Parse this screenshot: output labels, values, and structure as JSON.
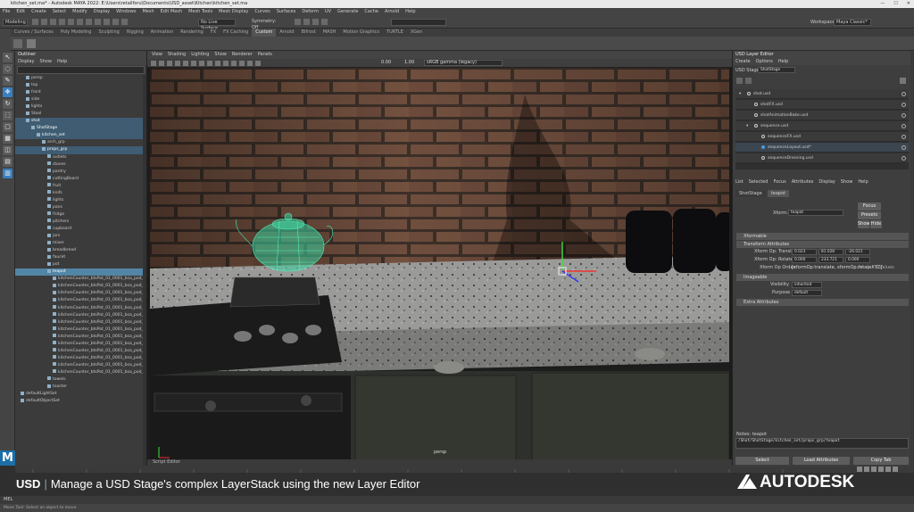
{
  "app": {
    "title": "kitchen_set.ma* - Autodesk MAYA 2022: E:\\Users\\retailforu\\Documents\\USD_asset\\Kitchen\\kitchen_set.ma",
    "window_controls": [
      "—",
      "☐",
      "✕"
    ]
  },
  "menubar": {
    "items": [
      "File",
      "Edit",
      "Create",
      "Select",
      "Modify",
      "Display",
      "Windows",
      "Mesh",
      "Edit Mesh",
      "Mesh Tools",
      "Mesh Display",
      "Curves",
      "Surfaces",
      "Deform",
      "UV",
      "Generate",
      "Cache",
      "Arnold",
      "Help"
    ]
  },
  "toolbar": {
    "mode": "Modeling",
    "live_surface": "No Live Surface",
    "symmetry": "Symmetry: Off",
    "workspace_label": "Workspace :",
    "workspace_value": "Maya Classic*"
  },
  "shelf_tabs": [
    "Curves / Surfaces",
    "Poly Modeling",
    "Sculpting",
    "Rigging",
    "Animation",
    "Rendering",
    "FX",
    "FX Caching",
    "Custom",
    "Arnold",
    "Bifrost",
    "MASH",
    "Motion Graphics",
    "TURTLE",
    "XGen"
  ],
  "shelf_active_tab": "Custom",
  "outliner": {
    "title": "Outliner",
    "menu": [
      "Display",
      "Show",
      "Help"
    ],
    "rows": [
      {
        "label": "persp",
        "state": ""
      },
      {
        "label": "top",
        "state": ""
      },
      {
        "label": "front",
        "state": ""
      },
      {
        "label": "side",
        "state": ""
      },
      {
        "label": "lights",
        "state": ""
      },
      {
        "label": "Stool",
        "state": ""
      },
      {
        "label": "shot",
        "state": "sel2"
      },
      {
        "label": "ShotStage",
        "state": "sel2"
      },
      {
        "label": "kitchen_set",
        "state": "sel2"
      },
      {
        "label": "arch_grp",
        "state": ""
      },
      {
        "label": "props_grp",
        "state": "sel2"
      },
      {
        "label": "outlets",
        "state": ""
      },
      {
        "label": "stoves",
        "state": ""
      },
      {
        "label": "pantry",
        "state": ""
      },
      {
        "label": "cuttingBoard",
        "state": ""
      },
      {
        "label": "fruit",
        "state": ""
      },
      {
        "label": "knifs",
        "state": ""
      },
      {
        "label": "lights",
        "state": ""
      },
      {
        "label": "pans",
        "state": ""
      },
      {
        "label": "fridge",
        "state": ""
      },
      {
        "label": "pitchers",
        "state": ""
      },
      {
        "label": "cupboard",
        "state": ""
      },
      {
        "label": "jars",
        "state": ""
      },
      {
        "label": "mixer",
        "state": ""
      },
      {
        "label": "breadbread",
        "state": ""
      },
      {
        "label": "faucet",
        "state": ""
      },
      {
        "label": "pot",
        "state": ""
      },
      {
        "label": "teapot",
        "state": "sel"
      },
      {
        "label": "kitchenCounter_btsPot_01_0001_bsa_pod_01",
        "state": ""
      },
      {
        "label": "kitchenCounter_btsPot_01_0001_bsa_pod_02",
        "state": ""
      },
      {
        "label": "kitchenCounter_btsPot_01_0001_bsa_pod_03",
        "state": ""
      },
      {
        "label": "kitchenCounter_btsPot_01_0001_bsa_pod_04",
        "state": ""
      },
      {
        "label": "kitchenCounter_btsPot_01_0001_bsa_pod_05",
        "state": ""
      },
      {
        "label": "kitchenCounter_btsPot_01_0001_bsa_pod_06",
        "state": ""
      },
      {
        "label": "kitchenCounter_btsPot_01_0001_bsa_pod_07",
        "state": ""
      },
      {
        "label": "kitchenCounter_btsPot_01_0001_bsa_pod_08",
        "state": ""
      },
      {
        "label": "kitchenCounter_btsPot_01_0001_bsa_pod_09",
        "state": ""
      },
      {
        "label": "kitchenCounter_btsPot_01_0001_bsa_pod_10",
        "state": ""
      },
      {
        "label": "kitchenCounter_btsPot_01_0001_bsa_pod_11",
        "state": ""
      },
      {
        "label": "kitchenCounter_btsPot_01_0001_bsa_pod_12",
        "state": ""
      },
      {
        "label": "kitchenCounter_btsPot_01_0001_bsa_pod_13",
        "state": ""
      },
      {
        "label": "kitchenCounter_btsPot_01_0001_bsa_pod_14",
        "state": ""
      },
      {
        "label": "towels",
        "state": ""
      },
      {
        "label": "toaster",
        "state": ""
      },
      {
        "label": "defaultLightSet",
        "state": ""
      },
      {
        "label": "defaultObjectSet",
        "state": ""
      }
    ]
  },
  "viewport": {
    "menu": [
      "View",
      "Shading",
      "Lighting",
      "Show",
      "Renderer",
      "Panels"
    ],
    "exposure": "0.00",
    "gamma": "1.00",
    "color_space": "sRGB gamma (legacy)",
    "camera_label": "persp",
    "panel_footer": "Script Editor"
  },
  "layer_editor": {
    "title": "USD Layer Editor",
    "menu": [
      "Create",
      "Options",
      "Help"
    ],
    "stage_label": "USD Stage:",
    "stage_value": "ShotStage",
    "layers": [
      {
        "label": "shot.usd",
        "indent": 0,
        "expand": "▾"
      },
      {
        "label": "shotFX.usd",
        "indent": 1,
        "expand": ""
      },
      {
        "label": "shotAnimationBake.usd",
        "indent": 1,
        "expand": ""
      },
      {
        "label": "sequence.usd",
        "indent": 1,
        "expand": "▾"
      },
      {
        "label": "sequenceFX.usd",
        "indent": 2,
        "expand": ""
      },
      {
        "label": "sequenceLayout.usd*",
        "indent": 2,
        "expand": ""
      },
      {
        "label": "sequenceDressing.usd",
        "indent": 2,
        "expand": ""
      }
    ]
  },
  "attribute_editor": {
    "menu": [
      "List",
      "Selected",
      "Focus",
      "Attributes",
      "Display",
      "Show",
      "Help"
    ],
    "tabs": [
      "ShotStage",
      "teapot"
    ],
    "active_tab": "teapot",
    "name_label": "Xform:",
    "name_value": "teapot",
    "buttons": {
      "focus": "Focus",
      "presets": "Presets",
      "show": "Show",
      "hide": "Hide"
    },
    "sections": [
      "Xformable",
      "Transform Attributes",
      "Imageable",
      "Extra Attributes"
    ],
    "translate_label": "Xform Op: Translate",
    "translate": [
      "0.023",
      "81.028",
      "-26.021"
    ],
    "rotate_label": "Xform Op: Rotate XYZ",
    "rotate": [
      "0.000",
      "233.721",
      "0.000"
    ],
    "order_label": "Xform Op Order",
    "order_value": "[xformOp:translate, xformOp:rotateXYZ]",
    "order_tail": "Array • 2 Values",
    "visibility_label": "Visibility",
    "visibility_value": "inherited",
    "purpose_label": "Purpose",
    "purpose_value": "default",
    "notes_label": "Notes: teapot",
    "path_value": "/Shot/ShotStage/kitchen_set/props_grp/teapot",
    "footer_buttons": [
      "Select",
      "Load Attributes",
      "Copy Tab"
    ]
  },
  "bottom": {
    "caption_prefix": "USD",
    "caption_separator": "|",
    "caption_text": "Manage a USD Stage's complex LayerStack using the new Layer Editor",
    "brand": "AUTODESK",
    "mel_label": "MEL",
    "help_text": "Move Tool: Select an object to move"
  },
  "colors": {
    "accent": "#5285a6",
    "teapot_wire": "#4ff0b8",
    "brand": "#ffffff"
  }
}
